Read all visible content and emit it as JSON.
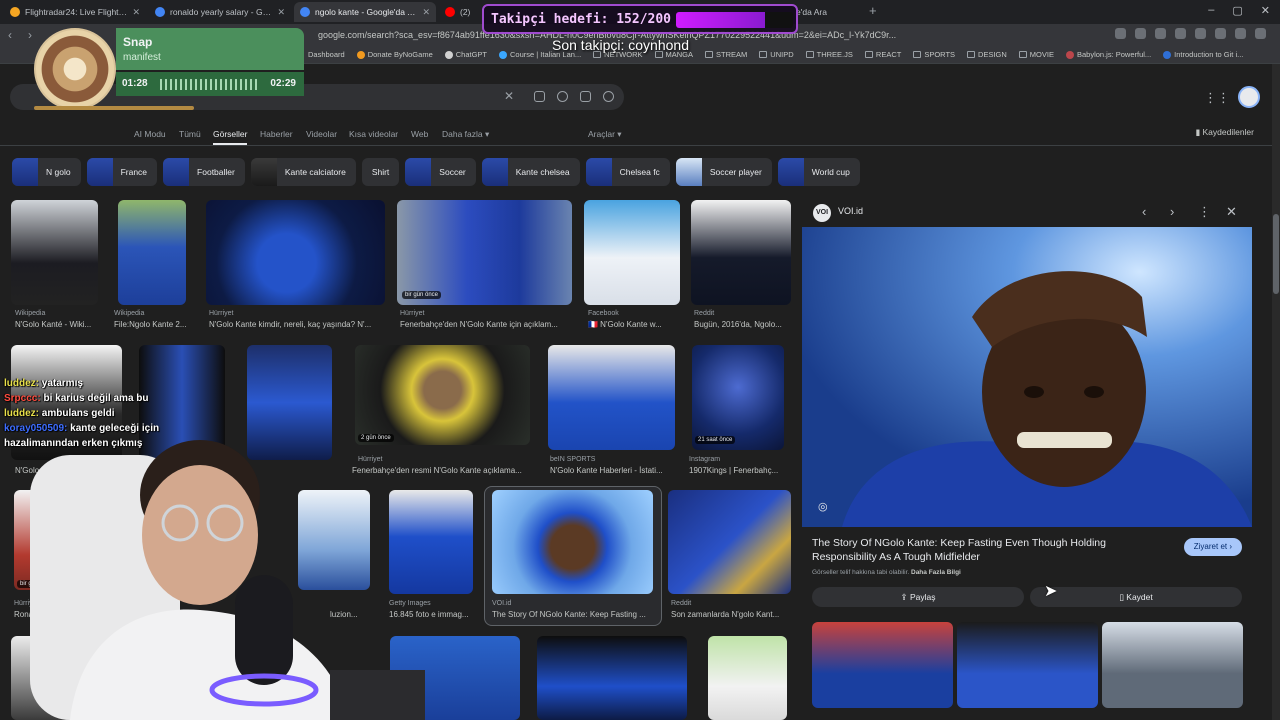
{
  "browser": {
    "tabs": [
      {
        "title": "Flightradar24: Live Flight Tracker - Re",
        "color": "#f5a623"
      },
      {
        "title": "ronaldo yearly salary - Google'da Ara",
        "color": "#4285f4"
      },
      {
        "title": "ngolo kante - Google'da Ara",
        "color": "#4285f4",
        "active": true
      },
      {
        "title": "(2) ",
        "color": "#ff0000"
      }
    ],
    "right_tab_title": "e'da Ara",
    "url": "google.com/search?sca_esv=f8674ab91ffe1630&sxsrf=AHDL-h0C9enBlovu8Cjr-AttywnSKelnQPZ1770229522441&udm=2&ei=ADc_l-Yk7dC9r..."
  },
  "bookmarks": [
    {
      "label": "Dashboard",
      "type": "folder"
    },
    {
      "label": "Donate ByNoGame",
      "type": "site"
    },
    {
      "label": "ChatGPT",
      "type": "site"
    },
    {
      "label": "Course | Italian Lan...",
      "type": "site"
    },
    {
      "label": "NETWORK",
      "type": "folder"
    },
    {
      "label": "MANGA",
      "type": "folder"
    },
    {
      "label": "STREAM",
      "type": "folder"
    },
    {
      "label": "UNIPD",
      "type": "folder"
    },
    {
      "label": "THREE.JS",
      "type": "folder"
    },
    {
      "label": "REACT",
      "type": "folder"
    },
    {
      "label": "SPORTS",
      "type": "folder"
    },
    {
      "label": "DESIGN",
      "type": "folder"
    },
    {
      "label": "MOVIE",
      "type": "folder"
    },
    {
      "label": "Babylon.js: Powerful...",
      "type": "site"
    },
    {
      "label": "Introduction to Git i...",
      "type": "site"
    }
  ],
  "search_tabs": {
    "ai_mode": "AI Modu",
    "all": "Tümü",
    "images": "Görseller",
    "news": "Haberler",
    "videos": "Videolar",
    "short_videos": "Kısa videolar",
    "web": "Web",
    "more": "Daha fazla ▾",
    "tools": "Araçlar ▾",
    "saved": "Kaydedilenler"
  },
  "chips": [
    {
      "label": "N golo",
      "thumb": true
    },
    {
      "label": "France",
      "thumb": true
    },
    {
      "label": "Footballer",
      "thumb": true
    },
    {
      "label": "Kante calciatore",
      "thumb": true
    },
    {
      "label": "Shirt",
      "thumb": false
    },
    {
      "label": "Soccer",
      "thumb": true
    },
    {
      "label": "Kante chelsea",
      "thumb": true
    },
    {
      "label": "Chelsea fc",
      "thumb": true
    },
    {
      "label": "Soccer player",
      "thumb": true
    },
    {
      "label": "World cup",
      "thumb": true
    }
  ],
  "results": {
    "row1": [
      {
        "source": "Wikipedia",
        "caption": "N'Golo Kanté - Wiki..."
      },
      {
        "source": "Wikipedia",
        "caption": "File:Ngolo Kante 2..."
      },
      {
        "source": "Hürriyet",
        "caption": "N'Golo Kante kimdir, nereli, kaç yaşında? N'..."
      },
      {
        "source": "Hürriyet",
        "caption": "Fenerbahçe'den N'Golo Kante için açıklam...",
        "badge": "bir gün önce"
      },
      {
        "source": "Facebook",
        "caption": "🇫🇷 N'Golo Kante w..."
      },
      {
        "source": "Reddit",
        "caption": "Bugün, 2016'da, Ngolo..."
      }
    ],
    "row2": [
      {
        "source": "Hürriyet",
        "caption": "Fenerbahçe'den resmi N'Golo Kante açıklama...",
        "badge": "2 gün önce"
      },
      {
        "source": "beIN SPORTS",
        "caption": "N'Golo Kante Haberleri - İstati..."
      },
      {
        "source": "Instagram",
        "caption": "1907Kings | Fenerbahç...",
        "badge": "21 saat önce"
      }
    ],
    "row2_left_caption": "N'Golo Kante - Soccer Ne...",
    "row3": [
      {
        "source": "Getty Images",
        "caption": "16.845 foto e immag..."
      },
      {
        "source": "VOI.id",
        "caption": "The Story Of NGolo Kante: Keep Fasting ..."
      },
      {
        "source": "Reddit",
        "caption": "Son zamanlarda N'golo Kant..."
      }
    ],
    "row3_left_badge": "bir gün önce",
    "row3_left_source": "Hürriy",
    "row3_left_caption": "Ronal",
    "row3_mid_caption": "luzion..."
  },
  "panel": {
    "logo": "VOI",
    "site": "VOI.id",
    "title": "The Story Of NGolo Kante: Keep Fasting Even Though Holding Responsibility As A Tough Midfielder",
    "visit": "Ziyaret et ›",
    "note": "Görseller telif hakkına tabi olabilir.",
    "note_link": "Daha Fazla Bilgi",
    "share": "Paylaş",
    "save": "Kaydet"
  },
  "overlay": {
    "snap": {
      "title": "Snap",
      "artist": "manifest",
      "elapsed": "01:28",
      "total": "02:29",
      "progress": 0.59
    },
    "follow_goal": {
      "label": "Takipçi hedefi: 152/200",
      "current": 152,
      "target": 200
    },
    "last_follower": "Son takipçi: coynhond",
    "chat": [
      {
        "user": "luddez:",
        "color": "#e8e04a",
        "text": " yatarmış"
      },
      {
        "user": "Srpccc:",
        "color": "#ff4b3e",
        "text": " bi karius değil ama bu"
      },
      {
        "user": "luddez:",
        "color": "#e8e04a",
        "text": " ambulans geldi"
      },
      {
        "user": "koray050509:",
        "color": "#3d6dff",
        "text": " kante geleceği için hazalimanından erken çıkmış"
      }
    ]
  },
  "colors": {
    "accent": "#a8c7fa",
    "bg": "#1f1f1f",
    "surface": "#303134",
    "purple": "#a04bd0"
  }
}
